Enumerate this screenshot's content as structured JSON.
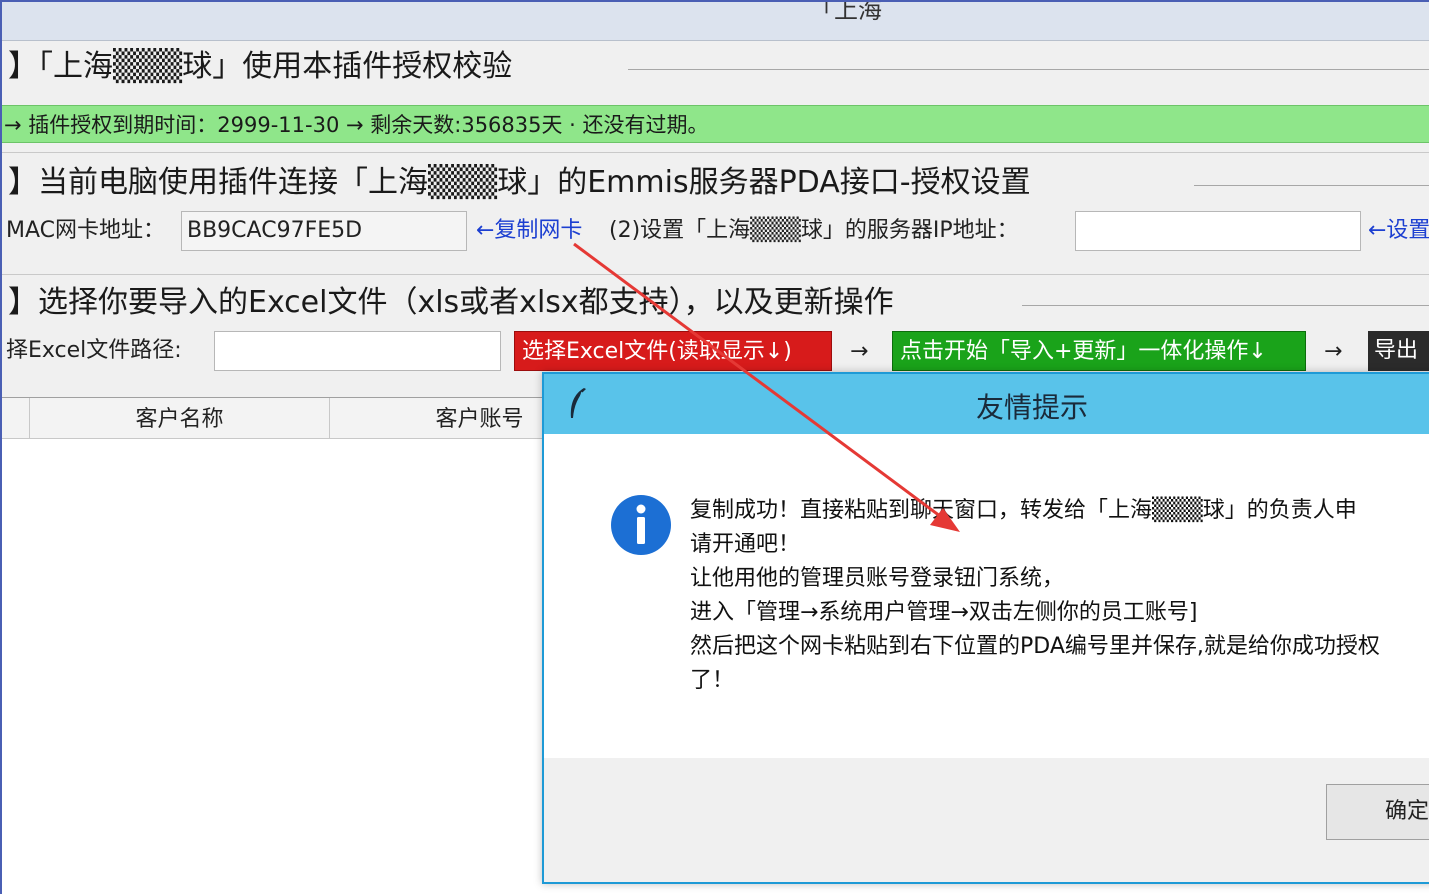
{
  "window": {
    "title_partial": "「上海"
  },
  "section1": {
    "title": "】「上海▒▒▒球」使用本插件授权校验",
    "license_status": "→ 插件授权到期时间：2999-11-30 → 剩余天数:356835天 · 还没有过期。"
  },
  "section2": {
    "title": "】当前电脑使用插件连接「上海▒▒▒球」的Emmis服务器PDA接口-授权设置",
    "mac_label": "MAC网卡地址：",
    "mac_value": "BB9CAC97FE5D",
    "copy_link": "←复制网卡",
    "server_ip_label": "(2)设置「上海▒▒▒球」的服务器IP地址：",
    "server_ip_value": "",
    "set_link": "←设置"
  },
  "section3": {
    "title": "】选择你要导入的Excel文件（xls或者xlsx都支持），以及更新操作",
    "path_label": "择Excel文件路径:",
    "path_value": "",
    "select_button": "选择Excel文件(读取显示↓)",
    "arrow1": "→",
    "start_button": "点击开始「导入+更新」一体化操作↓",
    "arrow2": "→",
    "export_button": "导出"
  },
  "grid": {
    "columns": [
      "",
      "客户名称",
      "客户账号"
    ]
  },
  "dialog": {
    "title": "友情提示",
    "message_lines": [
      "复制成功！直接粘贴到聊天窗口，转发给「上海▒▒▒球」的负责人申",
      "请开通吧！",
      "让他用他的管理员账号登录钮门系统，",
      "进入「管理→系统用户管理→双击左侧你的员工账号]",
      "然后把这个网卡粘贴到右下位置的PDA编号里并保存,就是给你成功授权",
      "了！"
    ],
    "ok_button": "确定"
  },
  "colors": {
    "license_bar": "#8fe68a",
    "select_button": "#d71b1b",
    "start_button": "#1aa31a",
    "dialog_titlebar": "#59c3ea",
    "annotation_arrow": "#e53935"
  }
}
